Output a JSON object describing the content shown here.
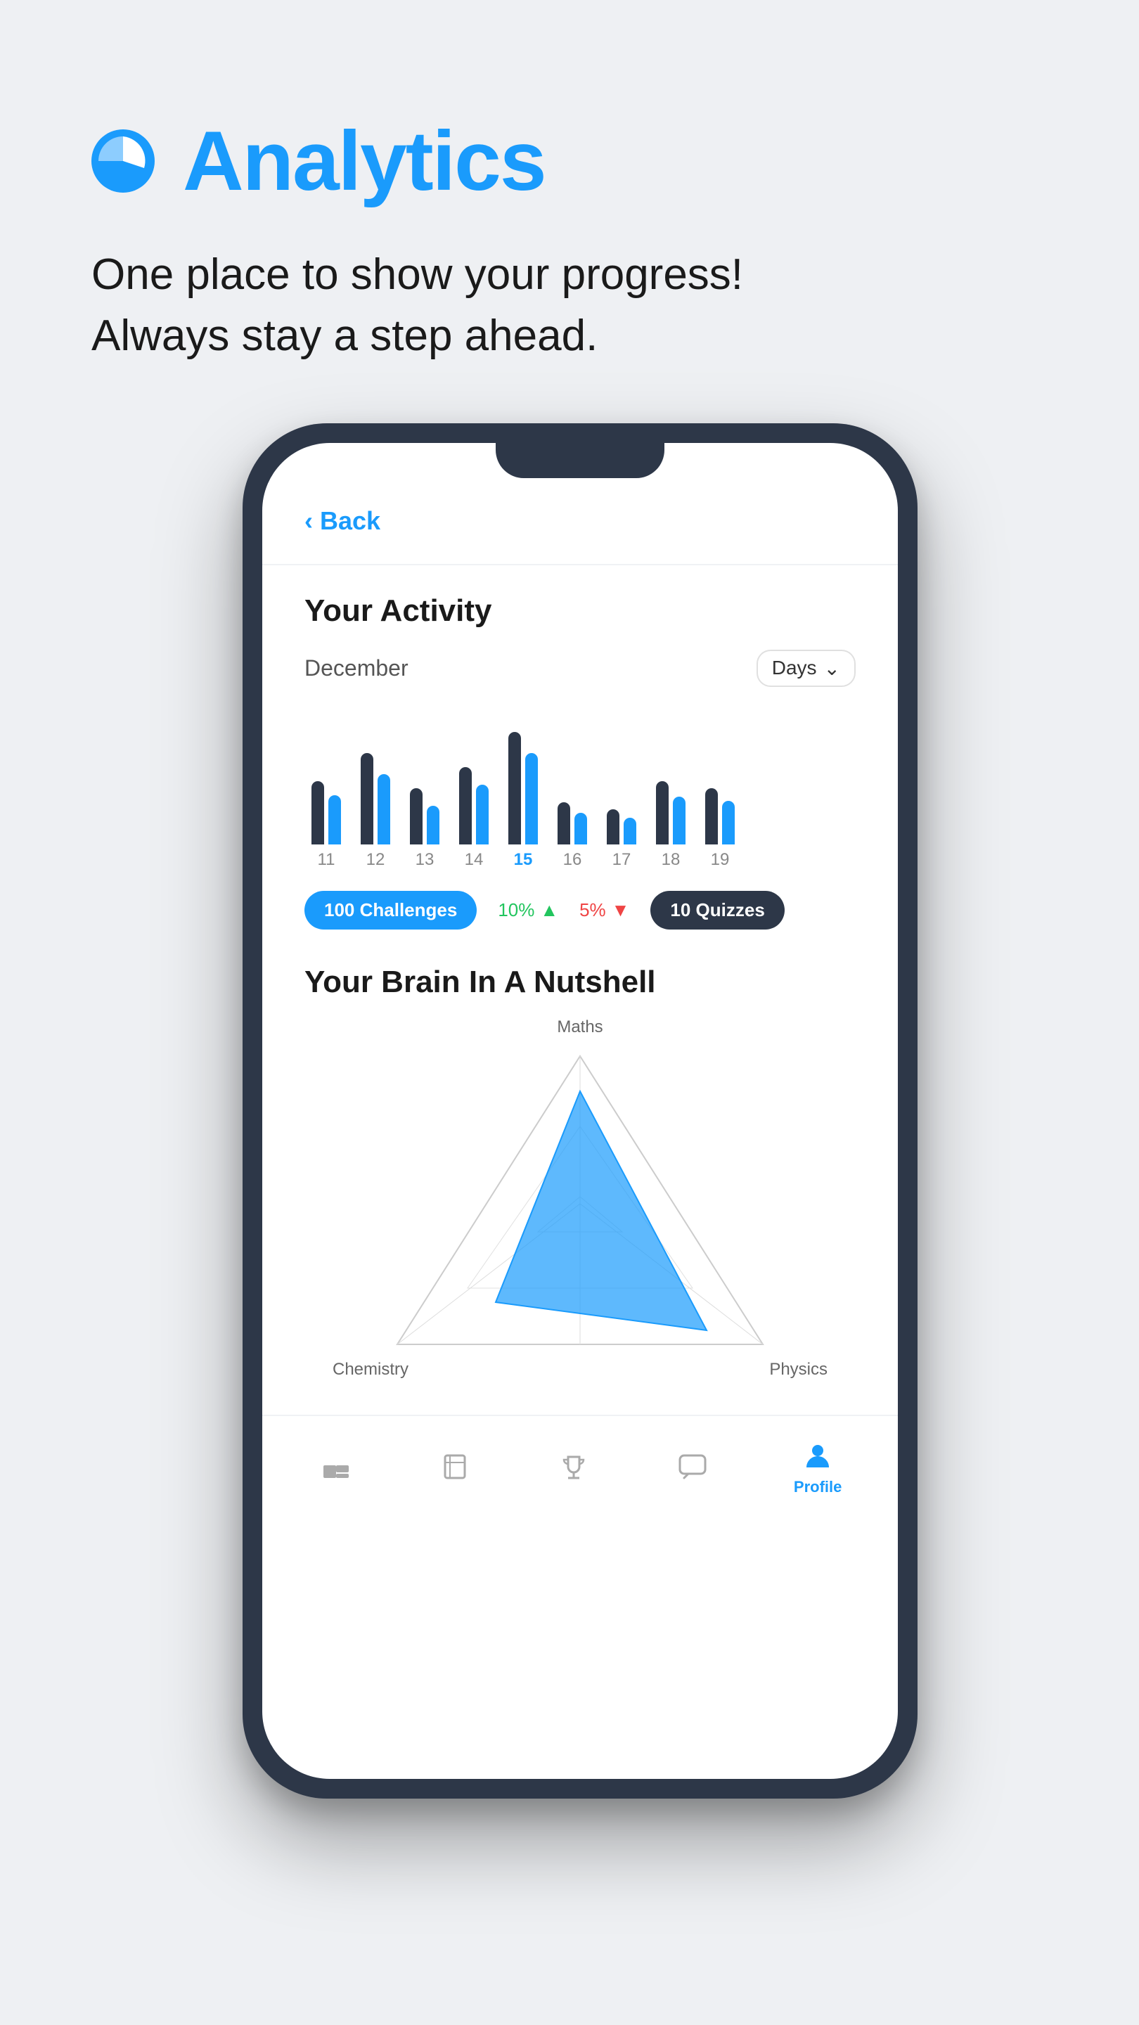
{
  "header": {
    "title": "Analytics",
    "subtitle_line1": "One place to show your progress!",
    "subtitle_line2": "Always stay a step ahead."
  },
  "phone": {
    "back_label": "Back",
    "screen": {
      "activity": {
        "section_title": "Your Activity",
        "month": "December",
        "period_selector": "Days",
        "bars": [
          {
            "label": "11",
            "dark_h": 120,
            "blue_h": 90,
            "active": false
          },
          {
            "label": "12",
            "dark_h": 160,
            "blue_h": 130,
            "active": false
          },
          {
            "label": "13",
            "dark_h": 100,
            "blue_h": 70,
            "active": false
          },
          {
            "label": "14",
            "dark_h": 140,
            "blue_h": 110,
            "active": false
          },
          {
            "label": "15",
            "dark_h": 180,
            "blue_h": 150,
            "active": true
          },
          {
            "label": "16",
            "dark_h": 80,
            "blue_h": 60,
            "active": false
          },
          {
            "label": "17",
            "dark_h": 60,
            "blue_h": 45,
            "active": false
          },
          {
            "label": "18",
            "dark_h": 110,
            "blue_h": 85,
            "active": false
          },
          {
            "label": "19",
            "dark_h": 100,
            "blue_h": 80,
            "active": false
          }
        ],
        "badge_challenges": "100 Challenges",
        "stat_green": "10%",
        "stat_red": "5%",
        "badge_quizzes": "10 Quizzes"
      },
      "brain": {
        "section_title": "Your Brain In A Nutshell",
        "labels": {
          "top": "Maths",
          "bottom_left": "Chemistry",
          "bottom_right": "Physics"
        }
      },
      "nav": {
        "items": [
          {
            "label": "",
            "icon": "home-icon",
            "active": false
          },
          {
            "label": "",
            "icon": "book-icon",
            "active": false
          },
          {
            "label": "",
            "icon": "trophy-icon",
            "active": false
          },
          {
            "label": "",
            "icon": "chat-icon",
            "active": false
          },
          {
            "label": "Profile",
            "icon": "profile-icon",
            "active": true
          }
        ]
      }
    }
  },
  "colors": {
    "blue": "#1a9bfc",
    "dark": "#2d3748",
    "green": "#22c55e",
    "red": "#ef4444"
  }
}
